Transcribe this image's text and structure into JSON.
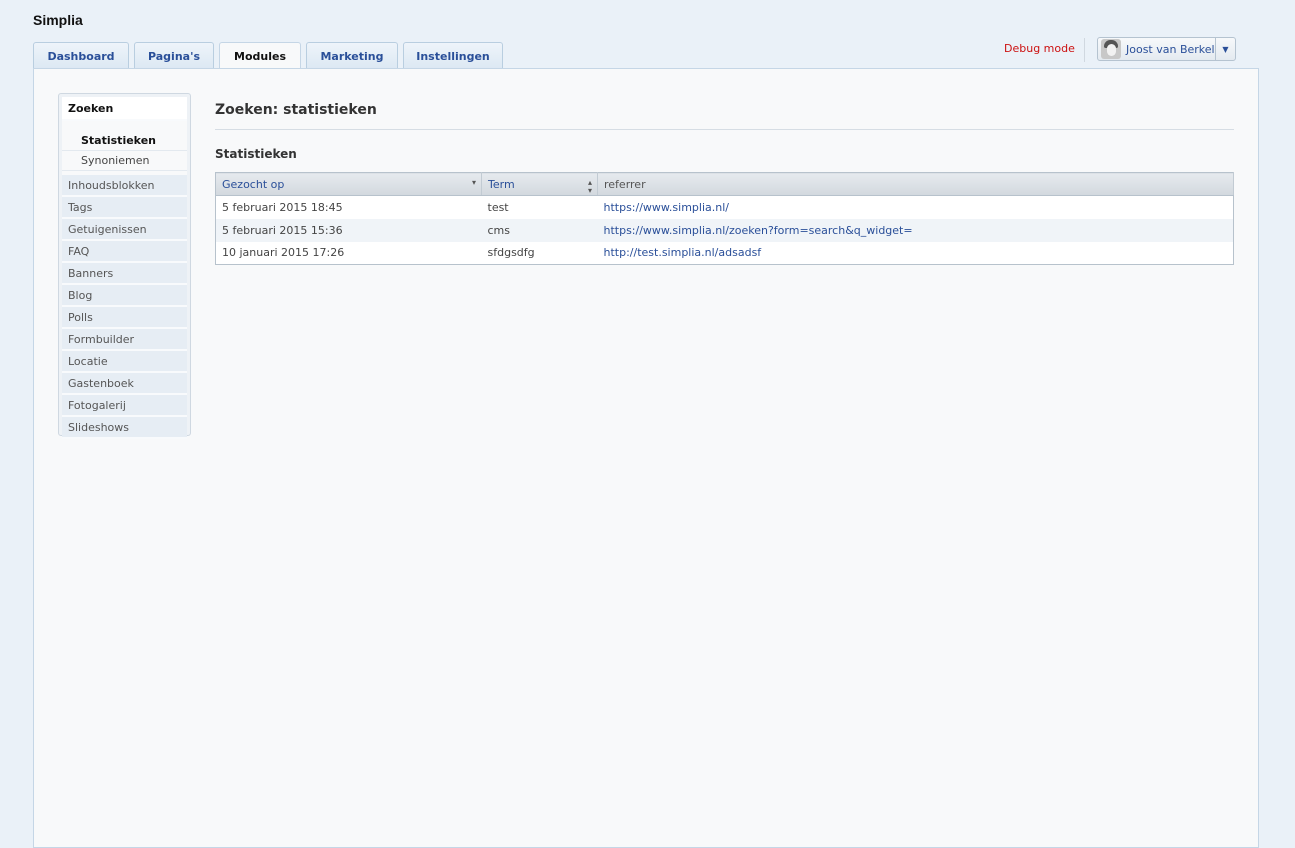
{
  "app": {
    "title": "Simplia"
  },
  "tabs": [
    {
      "label": "Dashboard",
      "active": false
    },
    {
      "label": "Pagina's",
      "active": false
    },
    {
      "label": "Modules",
      "active": true
    },
    {
      "label": "Marketing",
      "active": false
    },
    {
      "label": "Instellingen",
      "active": false
    }
  ],
  "header": {
    "debug_label": "Debug mode",
    "user_name": "Joost van Berkel",
    "caret": "▼"
  },
  "sidebar": {
    "active_item": "Zoeken",
    "sub_items": [
      "Statistieken",
      "Synoniemen"
    ],
    "items": [
      "Inhoudsblokken",
      "Tags",
      "Getuigenissen",
      "FAQ",
      "Banners",
      "Blog",
      "Polls",
      "Formbuilder",
      "Locatie",
      "Gastenboek",
      "Fotogalerij",
      "Slideshows"
    ]
  },
  "main": {
    "page_title": "Zoeken: statistieken",
    "section_title": "Statistieken",
    "table": {
      "columns": [
        "Gezocht op",
        "Term",
        "referrer"
      ],
      "rows": [
        [
          "5 februari 2015 18:45",
          "test",
          "https://www.simplia.nl/"
        ],
        [
          "5 februari 2015 15:36",
          "cms",
          "https://www.simplia.nl/zoeken?form=search&q_widget="
        ],
        [
          "10 januari 2015 17:26",
          "sfdgsdfg",
          "http://test.simplia.nl/adsadsf"
        ]
      ]
    }
  },
  "colors": {
    "link": "#2a4f99",
    "debug": "#cc1111",
    "page_bg": "#eaf1f8",
    "panel_bg": "#f8f9fa"
  }
}
